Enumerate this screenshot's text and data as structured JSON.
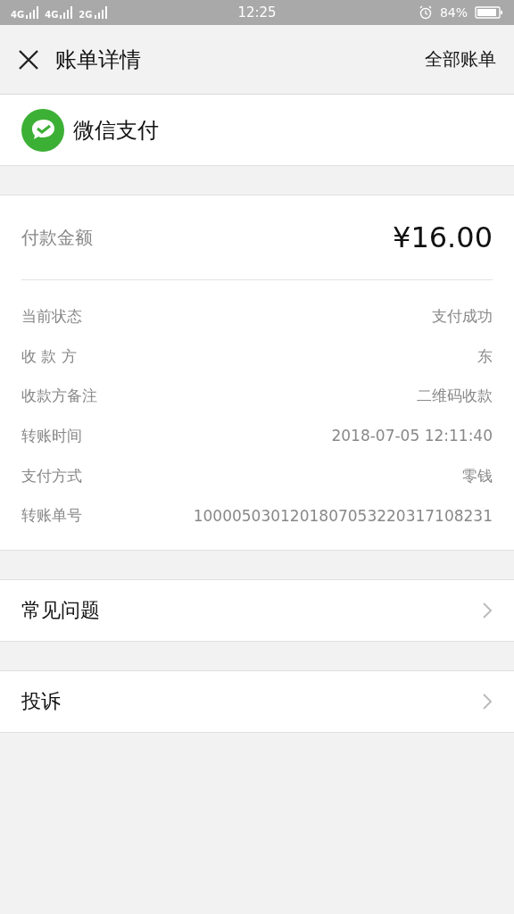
{
  "status_bar": {
    "networks": [
      "4G",
      "4G",
      "2G"
    ],
    "time": "12:25",
    "battery": "84%"
  },
  "nav": {
    "title": "账单详情",
    "action": "全部账单"
  },
  "merchant": {
    "name": "微信支付"
  },
  "amount": {
    "label": "付款金额",
    "value": "¥16.00"
  },
  "details": [
    {
      "label": "当前状态",
      "value": "支付成功"
    },
    {
      "label": "收 款 方",
      "value": "东"
    },
    {
      "label": "收款方备注",
      "value": "二维码收款"
    },
    {
      "label": "转账时间",
      "value": "2018-07-05 12:11:40"
    },
    {
      "label": "支付方式",
      "value": "零钱"
    },
    {
      "label": "转账单号",
      "value": "1000050301201807053220317108231"
    }
  ],
  "links": [
    {
      "label": "常见问题"
    },
    {
      "label": "投诉"
    }
  ]
}
